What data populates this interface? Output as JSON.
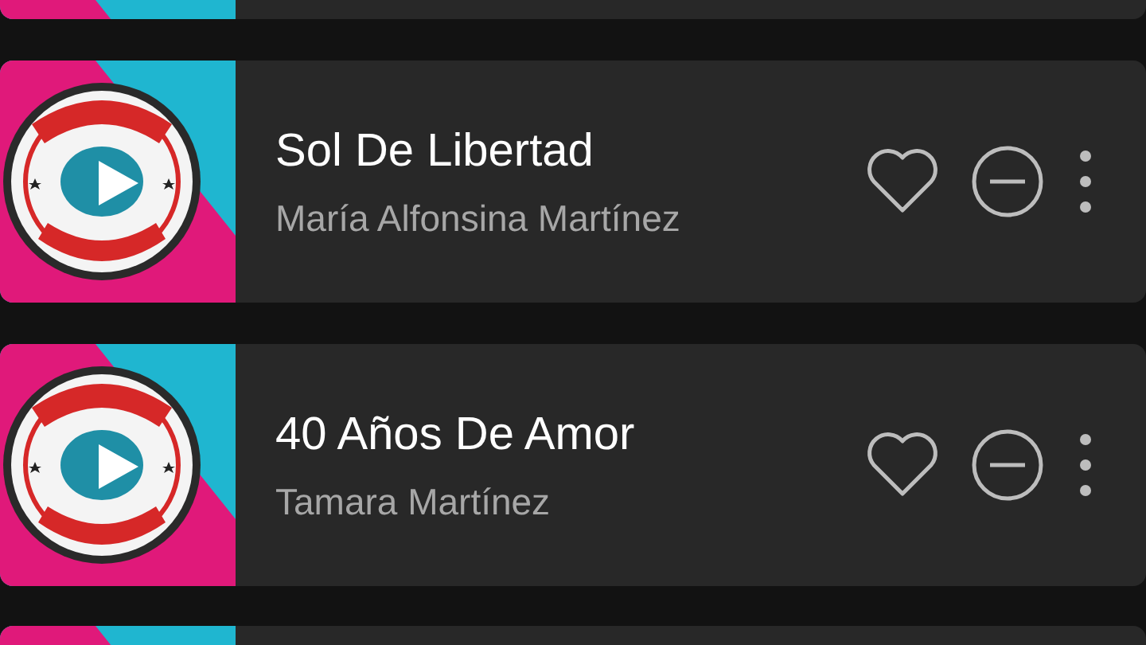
{
  "tracks": [
    {
      "title": "Sol De Libertad",
      "artist": "María Alfonsina Martínez"
    },
    {
      "title": "40 Años De Amor",
      "artist": "Tamara Martínez"
    }
  ]
}
